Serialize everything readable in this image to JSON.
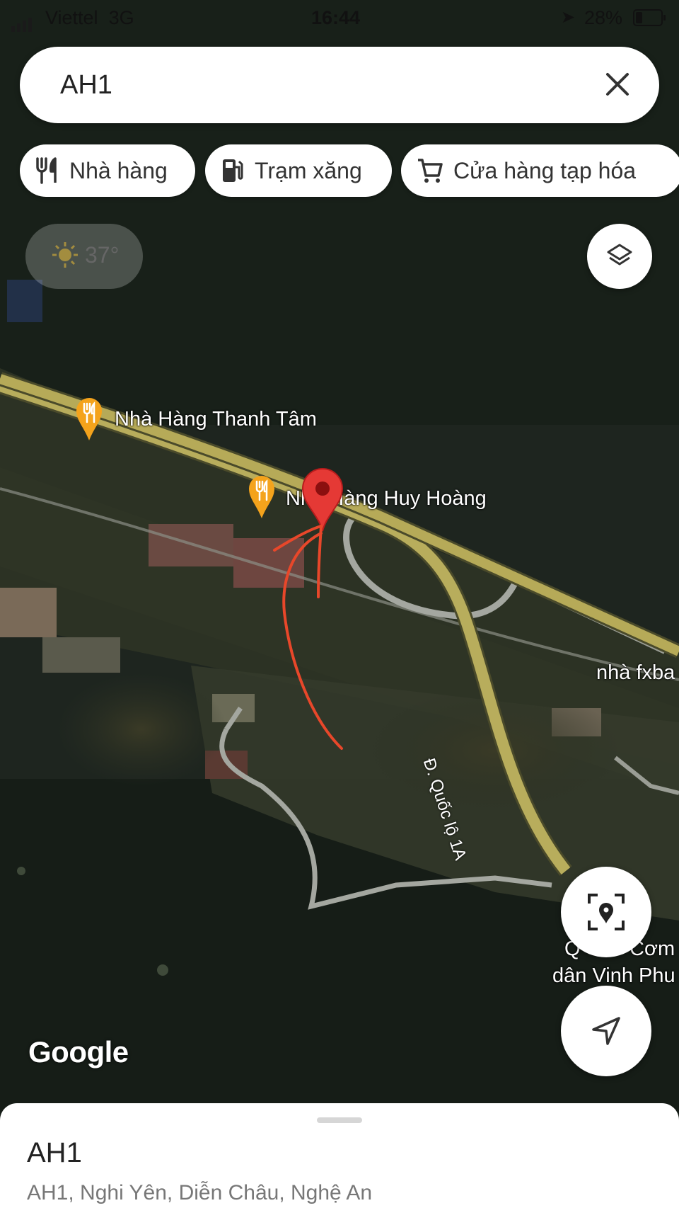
{
  "status_bar": {
    "carrier": "Viettel",
    "network": "3G",
    "time": "16:44",
    "battery": "28%"
  },
  "search": {
    "query": "AH1"
  },
  "chips": [
    {
      "label": "Nhà hàng",
      "icon": "fork-knife-icon"
    },
    {
      "label": "Trạm xăng",
      "icon": "gas-station-icon"
    },
    {
      "label": "Cửa hàng tạp hóa",
      "icon": "shopping-cart-icon"
    }
  ],
  "weather": {
    "temperature": "37°"
  },
  "map": {
    "places": [
      {
        "name": "Nhà Hàng Thanh Tâm",
        "icon": "restaurant-pin-icon"
      },
      {
        "name": "Nhà Hàng Huy Hoàng",
        "icon": "restaurant-pin-icon"
      }
    ],
    "road_label": "Đ. Quốc lộ 1A",
    "edge_labels": [
      "nhà fxba",
      "Q",
      "Cơm",
      "dân Vinh Phu"
    ],
    "attribution": "Google"
  },
  "bottom_sheet": {
    "title": "AH1",
    "address": "AH1, Nghi Yên, Diễn Châu, Nghệ An"
  },
  "colors": {
    "pin": "#e53935",
    "restaurant_pin": "#f4a31c",
    "annotation_arrow": "#e8472a"
  }
}
